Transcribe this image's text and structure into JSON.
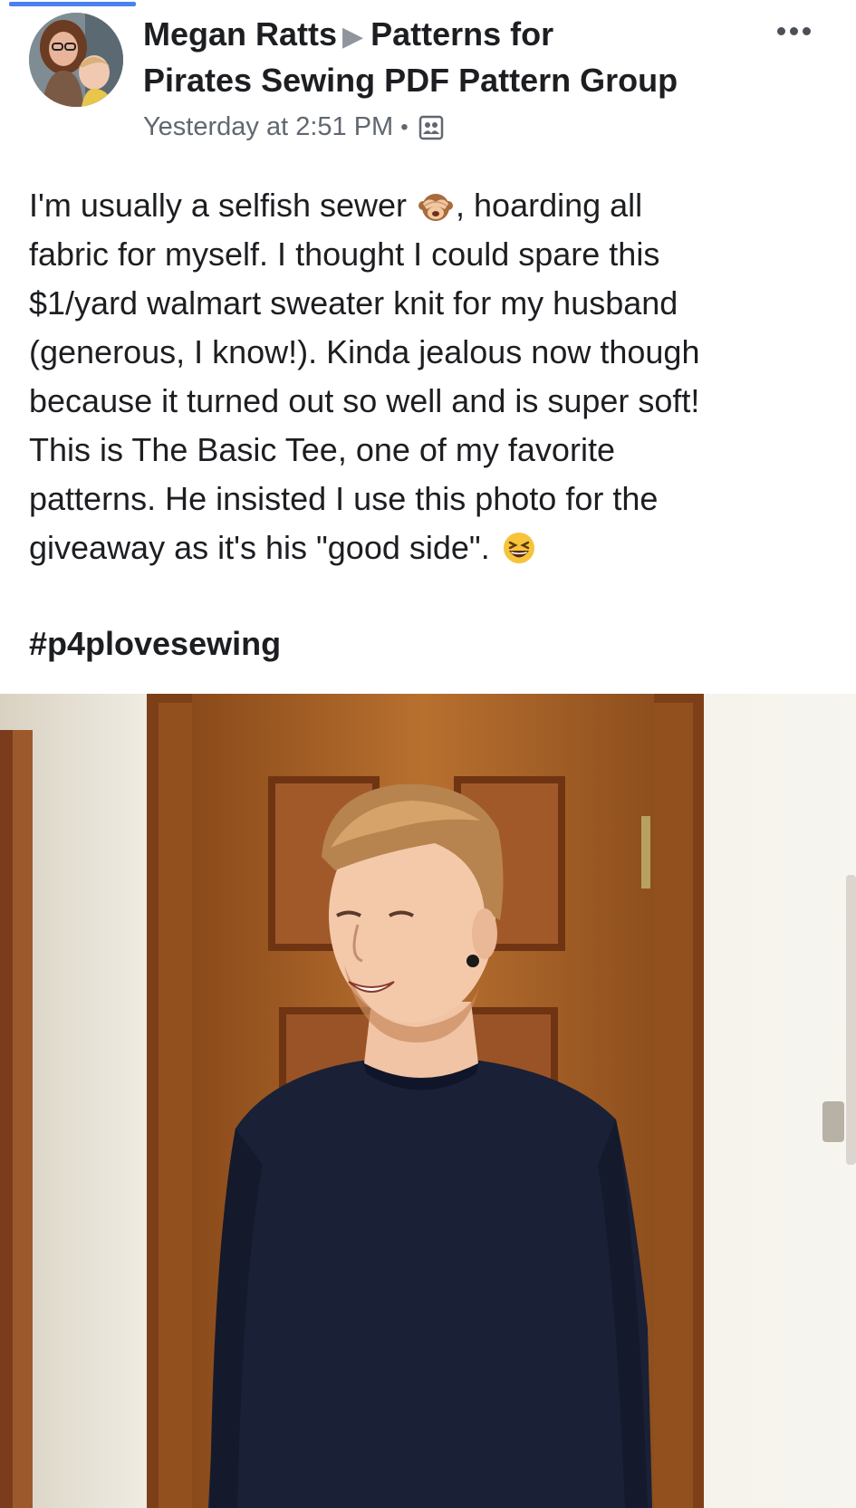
{
  "post": {
    "author": "Megan Ratts",
    "group": "Patterns for Pirates Sewing PDF Pattern Group",
    "group_line1": "Patterns for",
    "group_line2": "Pirates Sewing PDF Pattern Group",
    "timestamp": "Yesterday at 2:51 PM",
    "separator": "•",
    "privacy_icon": "group-icon",
    "more_icon": "more-dots-icon",
    "text_lines": [
      {
        "before": "I'm usually a selfish sewer ",
        "emoji": "see-no-evil-monkey-icon",
        "after": ", hoarding all"
      },
      {
        "before": "fabric for myself. I thought I could spare this"
      },
      {
        "before": "$1/yard walmart sweater knit for my husband"
      },
      {
        "before": "(generous, I know!). Kinda jealous now though"
      },
      {
        "before": "because it turned out so well and is super soft!"
      },
      {
        "before": "This is The Basic Tee, one of my favorite"
      },
      {
        "before": "patterns. He insisted I use this photo for the"
      },
      {
        "before": "giveaway as it's his \"good side\". ",
        "emoji": "laughing-face-icon"
      }
    ],
    "hashtag": "#p4plovesewing",
    "photo": "man-in-navy-long-sleeve-tee-photo"
  },
  "colors": {
    "text": "#1c1e21",
    "meta": "#616770",
    "door": "#a25a23",
    "wall": "#e8e3d6",
    "shirt": "#1a2036"
  }
}
